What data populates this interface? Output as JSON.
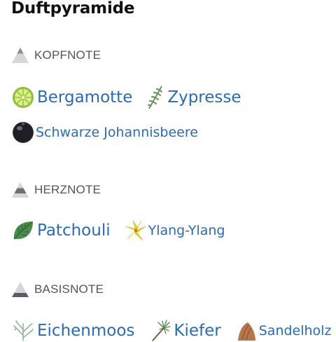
{
  "page": {
    "title": "Duftpyramide"
  },
  "sections": [
    {
      "label": "KOPFNOTE",
      "icon": "pyramid-top-icon"
    },
    {
      "label": "HERZNOTE",
      "icon": "pyramid-middle-icon"
    },
    {
      "label": "BASISNOTE",
      "icon": "pyramid-base-icon"
    }
  ],
  "notes": {
    "bergamotte": {
      "label": "Bergamotte",
      "icon": "bergamot-icon"
    },
    "zypresse": {
      "label": "Zypresse",
      "icon": "cypress-icon"
    },
    "johannisbeere": {
      "label": "Schwarze Johannisbeere",
      "icon": "blackcurrant-icon"
    },
    "patchouli": {
      "label": "Patchouli",
      "icon": "patchouli-leaf-icon"
    },
    "ylang": {
      "label": "Ylang-Ylang",
      "icon": "ylang-flower-icon"
    },
    "eichenmoos": {
      "label": "Eichenmoos",
      "icon": "oakmoss-icon"
    },
    "kiefer": {
      "label": "Kiefer",
      "icon": "pine-icon"
    },
    "sandelholz": {
      "label": "Sandelholz",
      "icon": "sandalwood-icon"
    }
  },
  "colors": {
    "link": "#2b6cb0",
    "heading": "#111111",
    "section": "#555555"
  }
}
